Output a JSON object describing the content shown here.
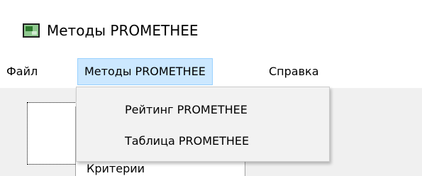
{
  "window": {
    "title": "Методы PROMETHEE",
    "icon": "app-window-icon"
  },
  "menubar": {
    "items": [
      {
        "label": "Файл",
        "active": false
      },
      {
        "label": "Методы PROMETHEE",
        "active": true
      },
      {
        "label": "Справка",
        "active": false
      }
    ]
  },
  "dropdown": {
    "items": [
      {
        "label": "Рейтинг PROMETHEE"
      },
      {
        "label": "Таблица PROMETHEE"
      }
    ]
  },
  "content": {
    "panel_label": "Критерии"
  },
  "colors": {
    "menu_highlight_bg": "#cce8ff",
    "menu_highlight_border": "#99d1ff",
    "dropdown_bg": "#f2f2f2"
  }
}
